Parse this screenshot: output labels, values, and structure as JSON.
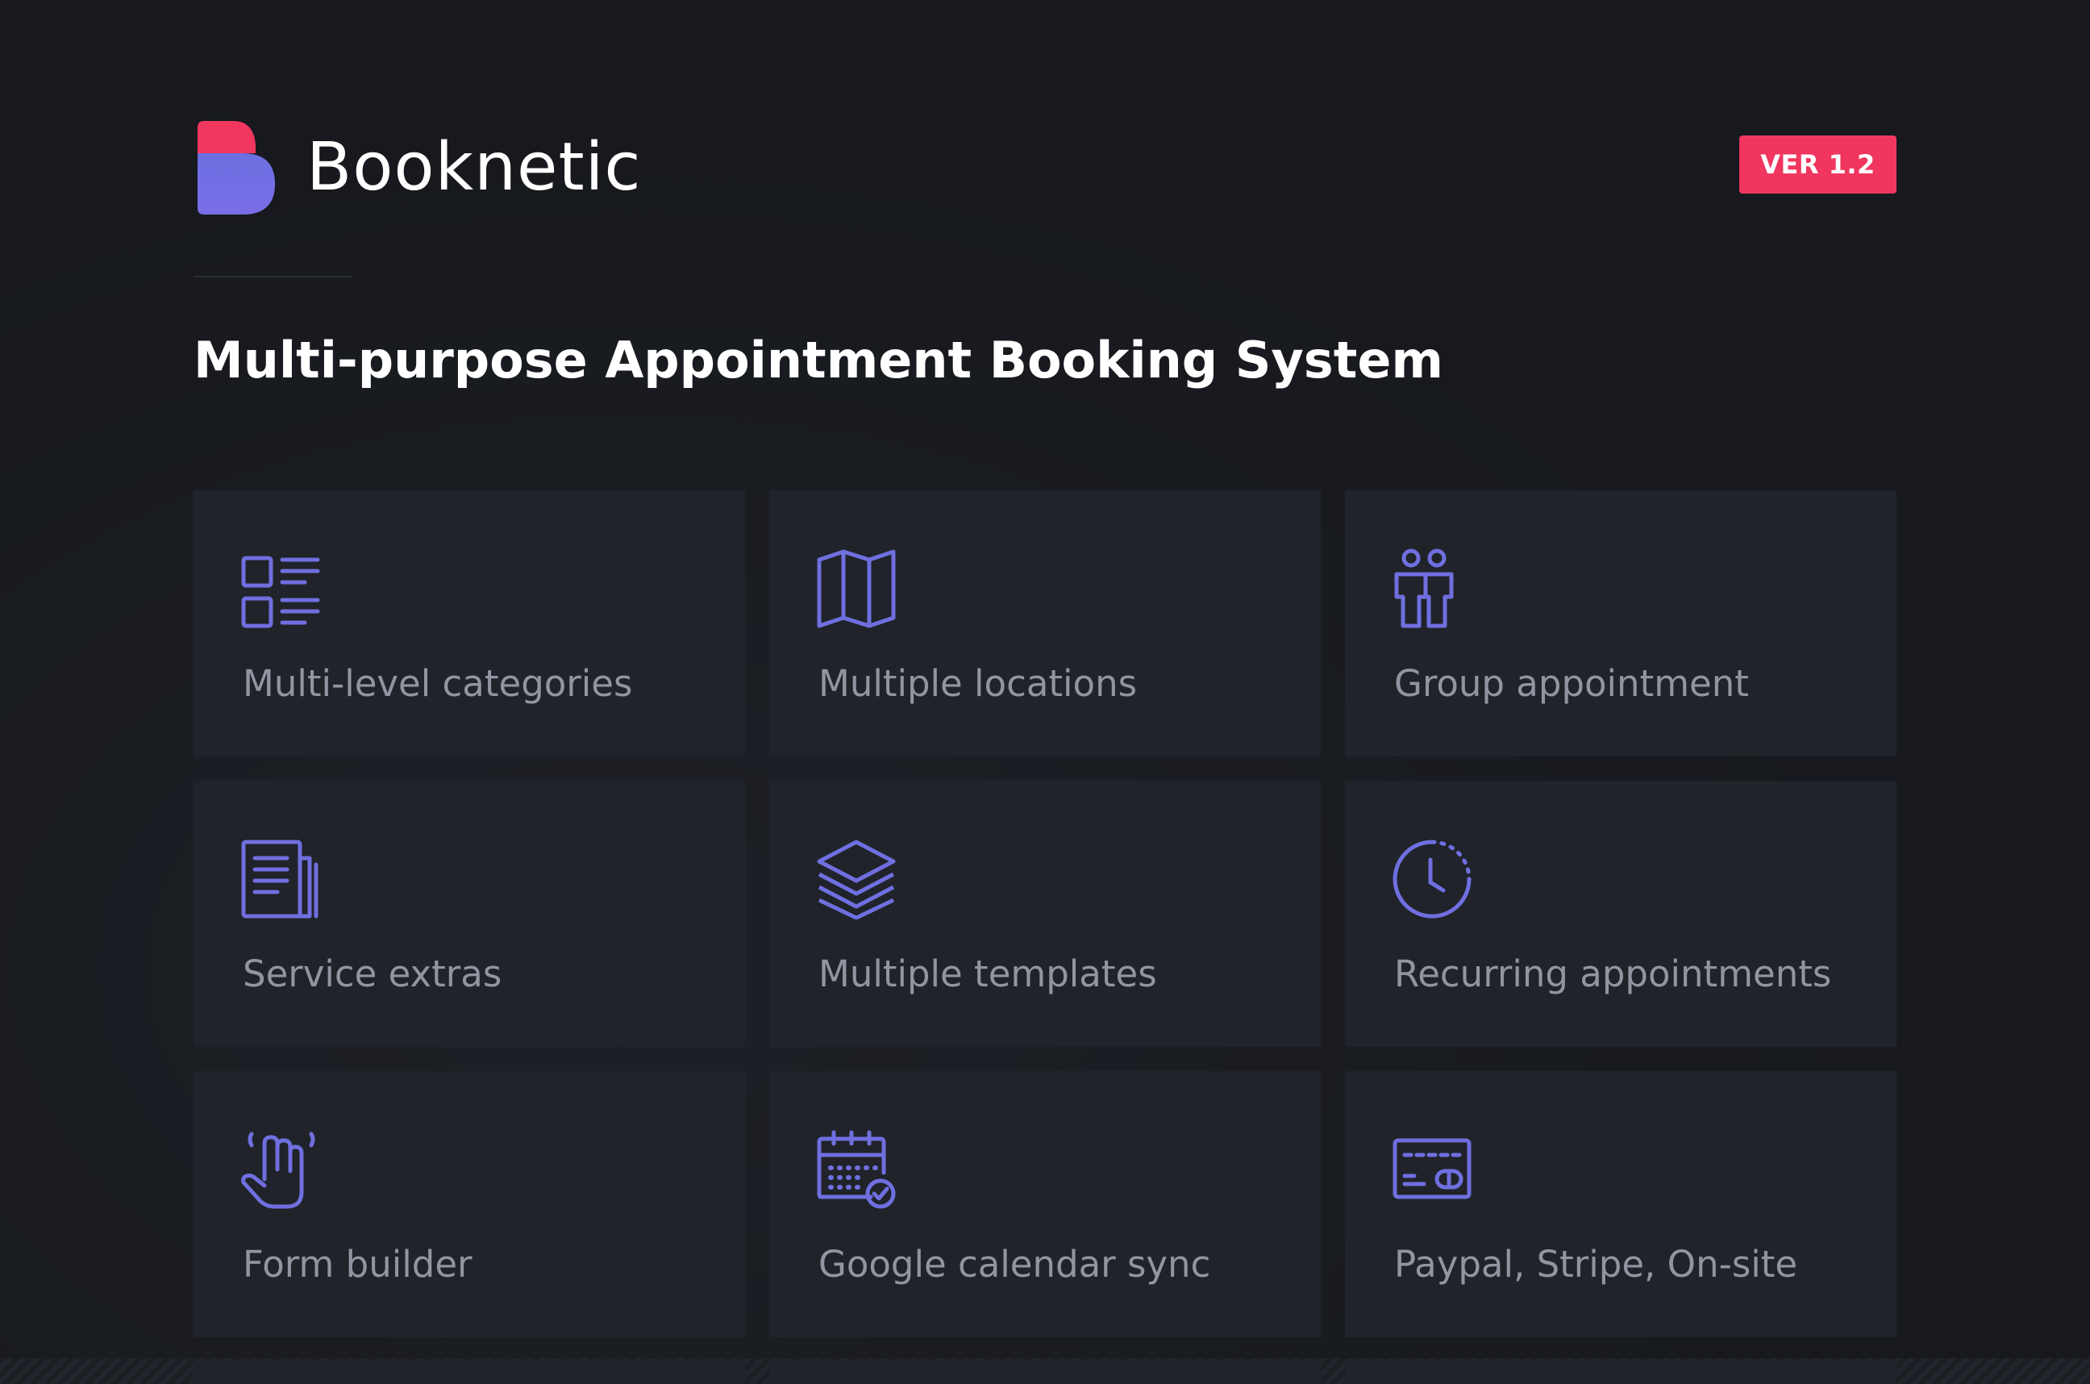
{
  "brand": {
    "name": "Booknetic",
    "version": "VER 1.2",
    "tagline": "Multi-purpose Appointment Booking System"
  },
  "colors": {
    "background": "#17191e",
    "card": "#202329",
    "accent": "#f0365f",
    "icon": "#6f6fe0",
    "label": "#9096a1"
  },
  "features": [
    {
      "label": "Multi-level categories",
      "icon": "categories-icon"
    },
    {
      "label": "Multiple locations",
      "icon": "map-icon"
    },
    {
      "label": "Group appointment",
      "icon": "group-icon"
    },
    {
      "label": "Service extras",
      "icon": "document-icon"
    },
    {
      "label": "Multiple templates",
      "icon": "layers-icon"
    },
    {
      "label": "Recurring appointments",
      "icon": "clock-icon"
    },
    {
      "label": "Form builder",
      "icon": "hand-pointer-icon"
    },
    {
      "label": "Google calendar sync",
      "icon": "calendar-check-icon"
    },
    {
      "label": "Paypal, Stripe, On-site",
      "icon": "payment-card-icon"
    }
  ]
}
